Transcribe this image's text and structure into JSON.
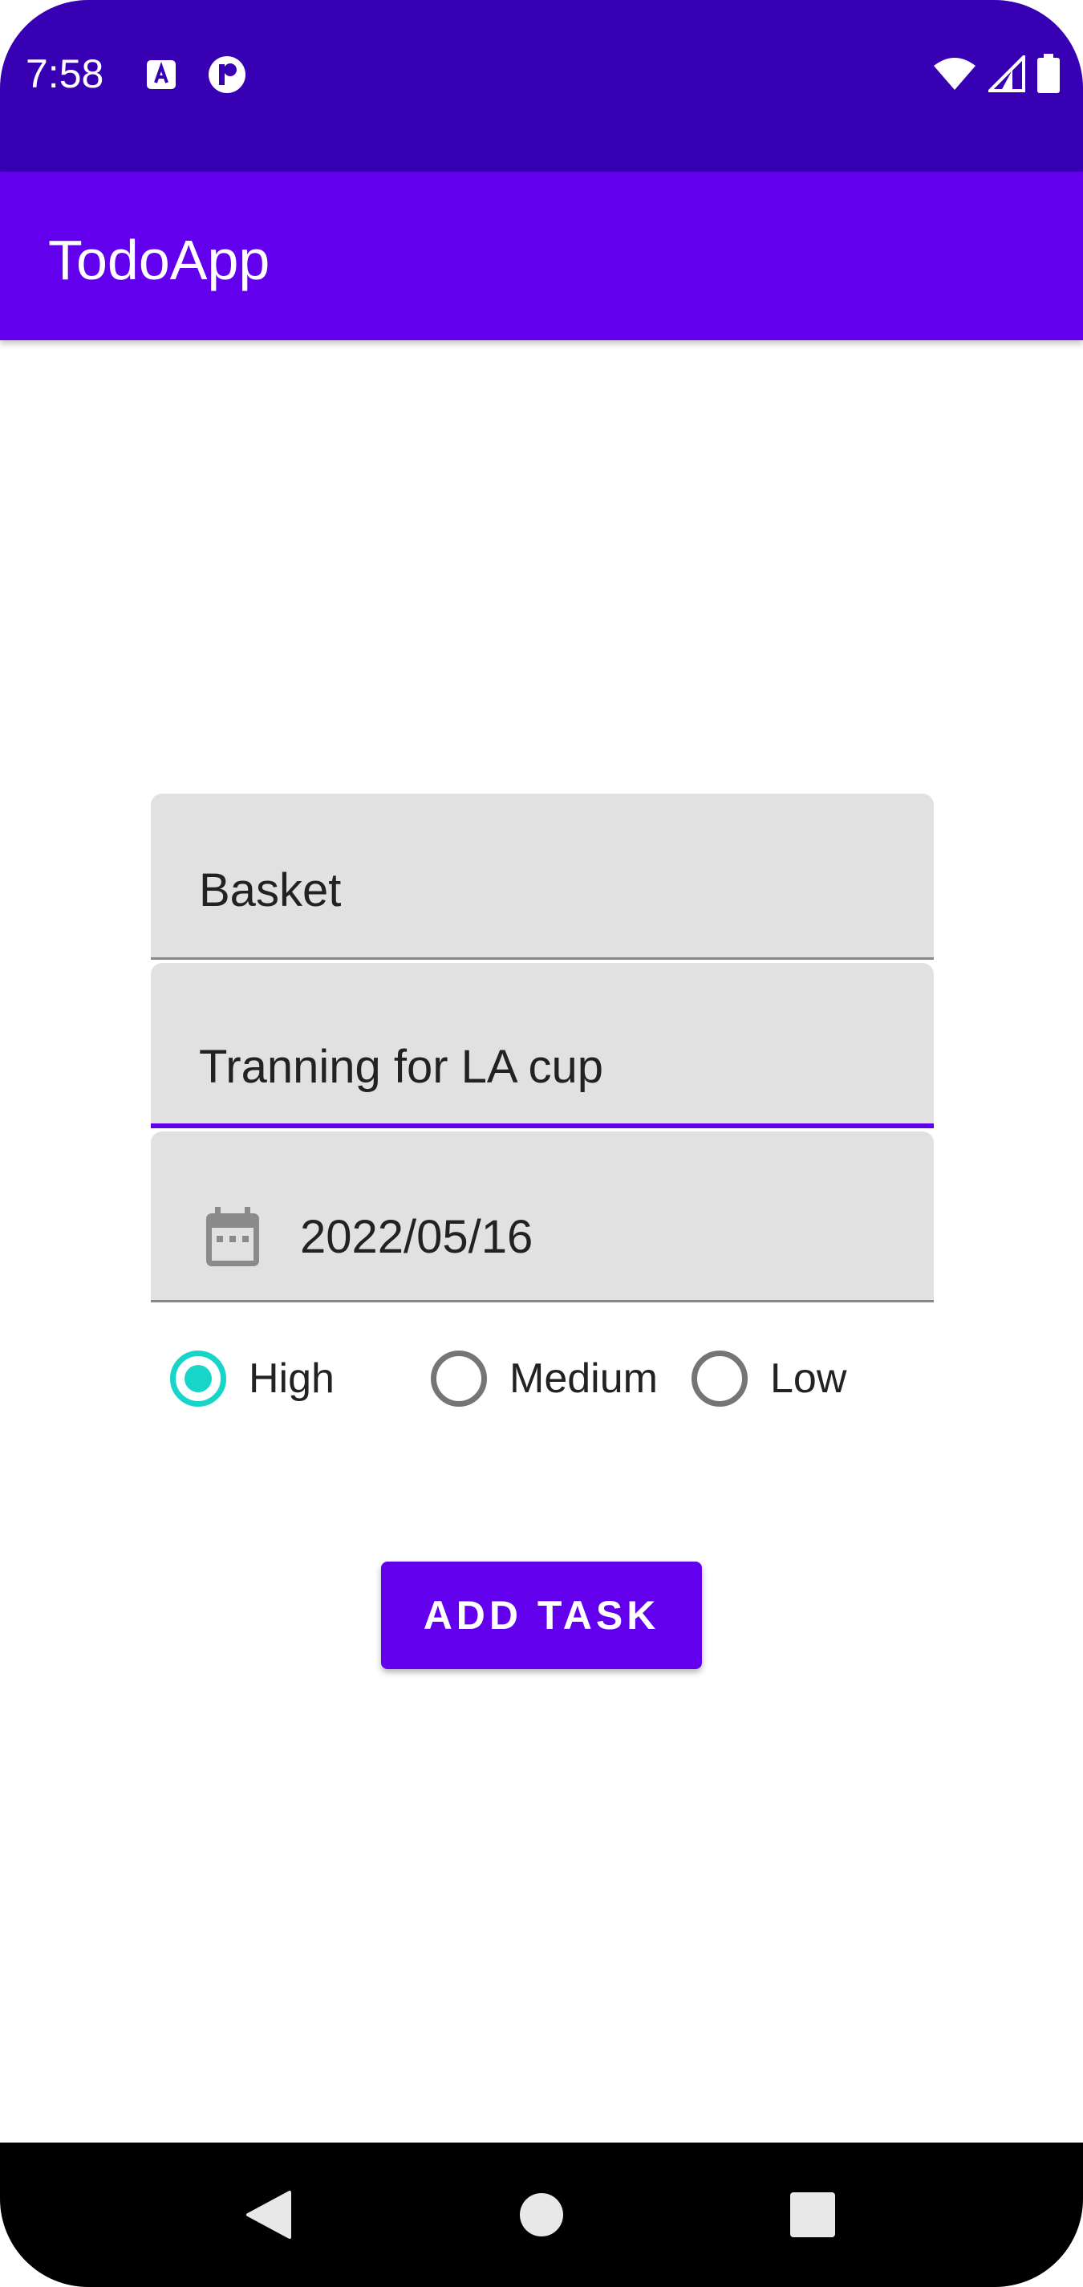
{
  "status_bar": {
    "time": "7:58",
    "icons": [
      "text-app-icon",
      "p-app-icon",
      "wifi-icon",
      "cellular-signal-icon",
      "battery-icon"
    ]
  },
  "app_bar": {
    "title": "TodoApp"
  },
  "form": {
    "title_field": {
      "value": "Basket"
    },
    "description_field": {
      "value": "Tranning for LA cup"
    },
    "date_field": {
      "value": "2022/05/16",
      "icon": "calendar-icon"
    },
    "priority": {
      "options": [
        "High",
        "Medium",
        "Low"
      ],
      "selected": "High"
    },
    "submit_label": "ADD TASK"
  },
  "navigation": {
    "buttons": [
      "back",
      "home",
      "recents"
    ]
  },
  "colors": {
    "status_bar": "#3700B3",
    "primary": "#6200EE",
    "radio_checked": "#17D6C9",
    "field_bg": "#E1E1E1"
  }
}
